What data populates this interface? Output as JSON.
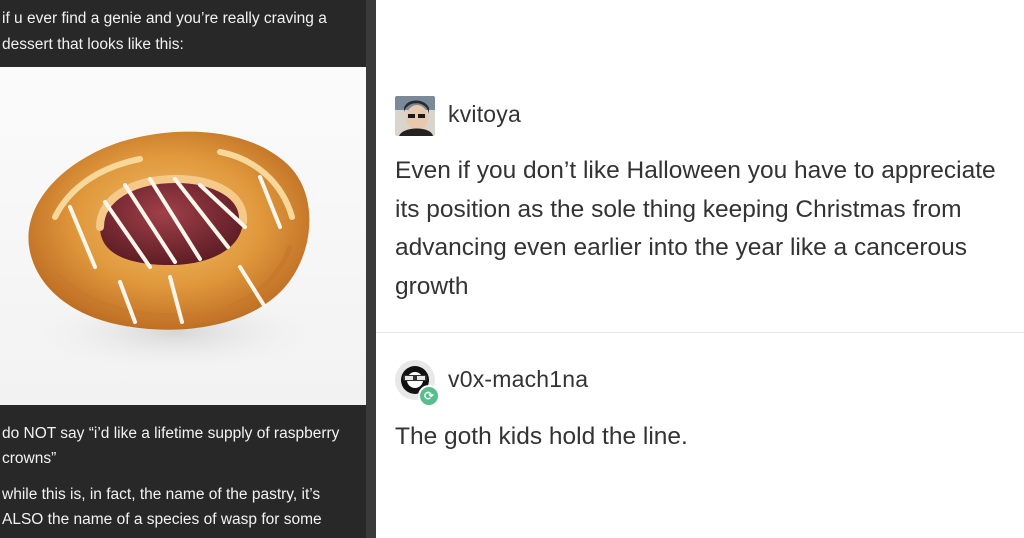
{
  "left_post": {
    "intro": "if u ever find a genie and you’re really craving a dessert that looks like this:",
    "image_alt": "raspberry crown danish pastry with icing drizzle",
    "paragraph1": "do NOT say “i’d like a lifetime supply of raspberry crowns”",
    "paragraph2": "while this is, in fact, the name of the pastry, it’s ALSO the name of a species of wasp for some"
  },
  "right_post": {
    "original": {
      "username": "kvitoya",
      "text": "Even if you don’t like Halloween you have to appreciate its position as the sole thing keeping Christmas from advancing even earlier into the year like a cancerous growth"
    },
    "reply": {
      "username": "v0x-mach1na",
      "text": "The goth kids hold the line."
    }
  },
  "colors": {
    "left_bg": "#282828",
    "right_bg": "#ffffff",
    "reblog_green": "#56bf8b"
  }
}
